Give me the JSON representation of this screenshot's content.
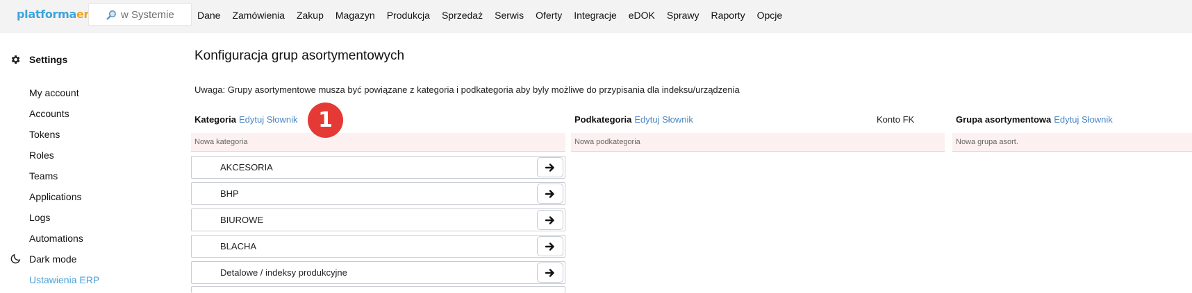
{
  "brand": {
    "part1": "platforma",
    "part2": "erp"
  },
  "search": {
    "placeholder": "w Systemie"
  },
  "menu": [
    "Dane",
    "Zamówienia",
    "Zakup",
    "Magazyn",
    "Produkcja",
    "Sprzedaż",
    "Serwis",
    "Oferty",
    "Integracje",
    "eDOK",
    "Sprawy",
    "Raporty",
    "Opcje"
  ],
  "sidebar": {
    "title": "Settings",
    "items": [
      "My account",
      "Accounts",
      "Tokens",
      "Roles",
      "Teams",
      "Applications",
      "Logs",
      "Automations"
    ],
    "dark_mode": "Dark mode",
    "active_item": "Ustawienia ERP"
  },
  "page": {
    "title": "Konfiguracja grup asortymentowych",
    "note": "Uwaga: Grupy asortymentowe musza być powiązane z kategoria i podkategoria aby byly możliwe do przypisania dla indeksu/urządzenia"
  },
  "columns": {
    "category": {
      "label": "Kategoria",
      "edit": "Edytuj Słownik",
      "new_placeholder": "Nowa kategoria"
    },
    "subcategory": {
      "label": "Podkategoria",
      "edit": "Edytuj Słownik",
      "new_placeholder": "Nowa podkategoria"
    },
    "konto": {
      "label": "Konto FK"
    },
    "group": {
      "label": "Grupa asortymentowa",
      "edit": "Edytuj Słownik",
      "new_placeholder": "Nowa grupa asort."
    }
  },
  "categories": [
    "AKCESORIA",
    "BHP",
    "BIUROWE",
    "BLACHA",
    "Detalowe / indeksy produkcyjne"
  ],
  "badge": "1",
  "icons": {
    "search": "magnifier-icon",
    "settings": "gear-icon",
    "dark": "moon-icon",
    "arrow": "arrow-right-icon"
  }
}
